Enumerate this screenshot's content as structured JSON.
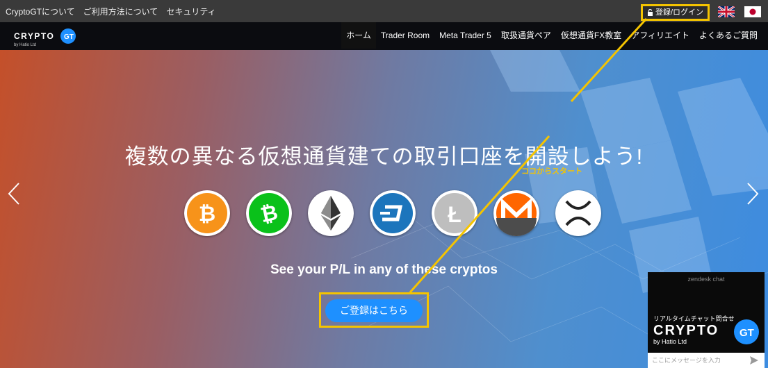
{
  "topbar": {
    "links": [
      "CryptoGTについて",
      "ご利用方法について",
      "セキュリティ"
    ],
    "login_label": "登録/ログイン"
  },
  "brand": {
    "logo_text": "CRYPTO",
    "logo_badge": "GT",
    "byline": "by Hatio Ltd"
  },
  "nav": {
    "items": [
      "ホーム",
      "Trader Room",
      "Meta Trader 5",
      "取扱通貨ペア",
      "仮想通貨FX教室",
      "アフィリエイト",
      "よくあるご質問"
    ],
    "active_index": 0
  },
  "hero": {
    "headline": "複数の異なる仮想通貨建ての取引口座を開設しよう!",
    "subline": "See your P/L in any of these cryptos",
    "cta_label": "ご登録はこちら",
    "annotation_note": "ココからスタート",
    "coins": [
      {
        "icon": "bitcoin-icon",
        "color": "#f7931a"
      },
      {
        "icon": "bitcoin-cash-icon",
        "color": "#0ac18e"
      },
      {
        "icon": "ethereum-icon",
        "color": "#ffffff"
      },
      {
        "icon": "dash-icon",
        "color": "#1c75bc"
      },
      {
        "icon": "litecoin-icon",
        "color": "#bebebe"
      },
      {
        "icon": "monero-icon",
        "color": "#ff6600"
      },
      {
        "icon": "ripple-icon",
        "color": "#ffffff"
      }
    ]
  },
  "chat": {
    "provider": "zendesk chat",
    "title_jp": "リアルタイムチャット問合せ",
    "logo_text": "CRYPTO",
    "logo_badge": "GT",
    "byline": "by Hatio Ltd",
    "input_placeholder": "ここにメッセージを入力"
  },
  "colors": {
    "highlight": "#f5c400",
    "cta": "#1e90ff",
    "topbar": "#3a3a3a"
  }
}
